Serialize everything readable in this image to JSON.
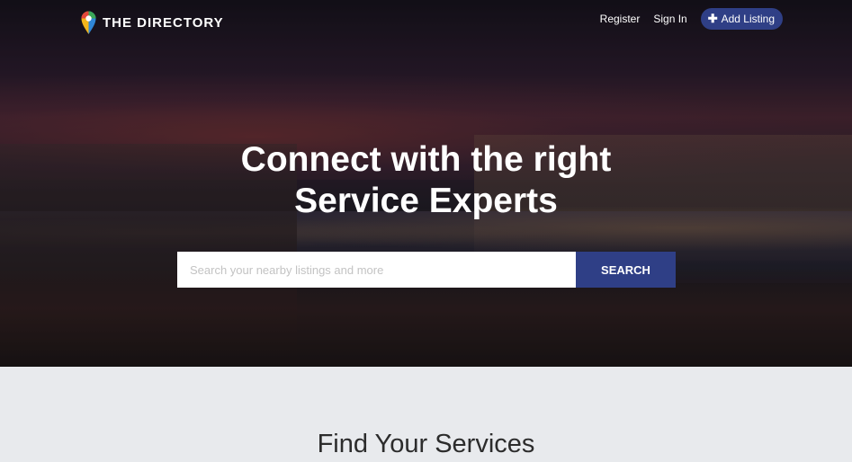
{
  "brand": {
    "name": "THE DIRECTORY"
  },
  "nav": {
    "register": "Register",
    "sign_in": "Sign In",
    "add_listing": "Add Listing"
  },
  "hero": {
    "headline_line1": "Connect with the right",
    "headline_line2": "Service Experts",
    "search_placeholder": "Search your nearby listings and more",
    "search_value": "",
    "search_button": "SEARCH"
  },
  "section": {
    "title": "Find Your Services"
  },
  "colors": {
    "accent": "#2f3f86",
    "section_bg": "#e8eaed",
    "title": "#2c2c2c"
  },
  "icons": {
    "logo": "map-pin-icon",
    "add": "plus-icon"
  }
}
